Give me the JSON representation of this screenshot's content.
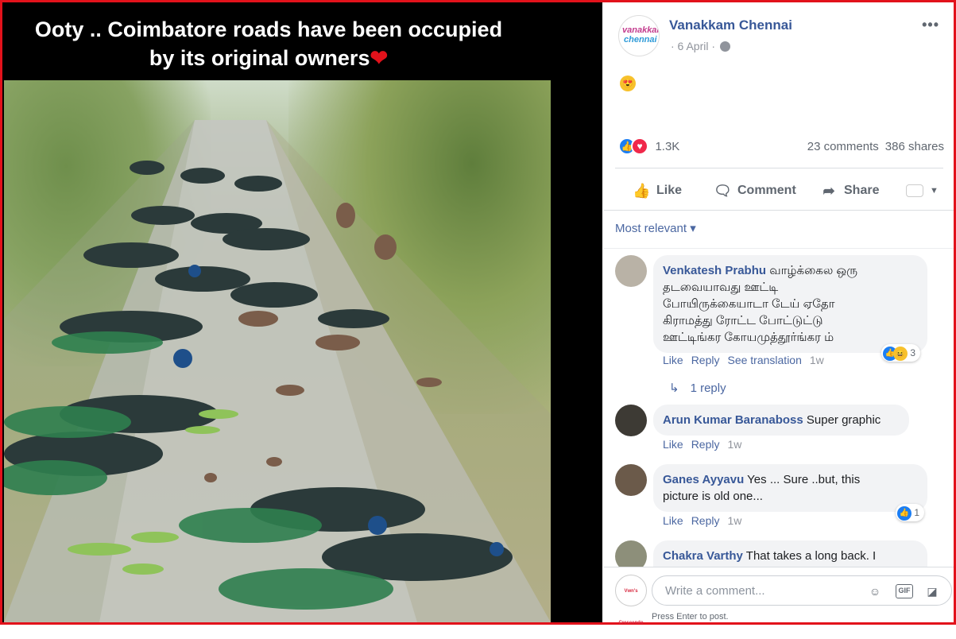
{
  "photo": {
    "caption_line1": "Ooty .. Coimbatore roads have been occupied",
    "caption_line2": "by its original owners",
    "caption_emoji": "❤"
  },
  "post": {
    "page_name": "Vanakkam Chennai",
    "page_logo_line1": "vanakkam",
    "page_logo_line2": "chennai",
    "date": "· 6 April ·",
    "more_icon": "•••",
    "post_text_emoji": "😍",
    "reaction_count": "1.3K",
    "comments_count": "23 comments",
    "shares_count": "386 shares"
  },
  "actions": {
    "like": "Like",
    "comment": "Comment",
    "share": "Share"
  },
  "sort": {
    "label": "Most relevant",
    "caret": "▾"
  },
  "comments": [
    {
      "name": "Venkatesh Prabhu",
      "lines": [
        "வாழ்க்கைல ஒரு",
        "தடவையாவது ஊட்டி",
        "போயிருக்கையாடா டேய் ஏதோ",
        "கிராமத்து ரோட்ட போட்டுட்டு",
        "ஊட்டிங்கர கோயமுத்தூர்ங்கர ம்"
      ],
      "first_line_suffix": " வாழ்க்கைல ஒரு",
      "meta": {
        "like": "Like",
        "reply": "Reply",
        "translate": "See translation",
        "time": "1w"
      },
      "reactions": "3"
    },
    {
      "name": "Arun Kumar Baranaboss",
      "text": " Super graphic",
      "meta": {
        "like": "Like",
        "reply": "Reply",
        "time": "1w"
      }
    },
    {
      "name": "Ganes Ayyavu",
      "text": " Yes ... Sure ..but, this",
      "text2": "picture is old one...",
      "meta": {
        "like": "Like",
        "reply": "Reply",
        "time": "1w"
      },
      "reactions": "1"
    },
    {
      "name": "Chakra Varthy",
      "text": " That takes a long back. I"
    }
  ],
  "reply_link": {
    "arrow": "↳",
    "label": "1 reply"
  },
  "composer": {
    "placeholder": "Write a comment...",
    "hint": "Press Enter to post.",
    "gif_label": "GIF",
    "avatar_text": "Vwn's Crescendo"
  },
  "colors": {
    "frame": "#e2121b",
    "link": "#385898",
    "like_blue": "#1b7ef3",
    "love_red": "#f0284a"
  }
}
